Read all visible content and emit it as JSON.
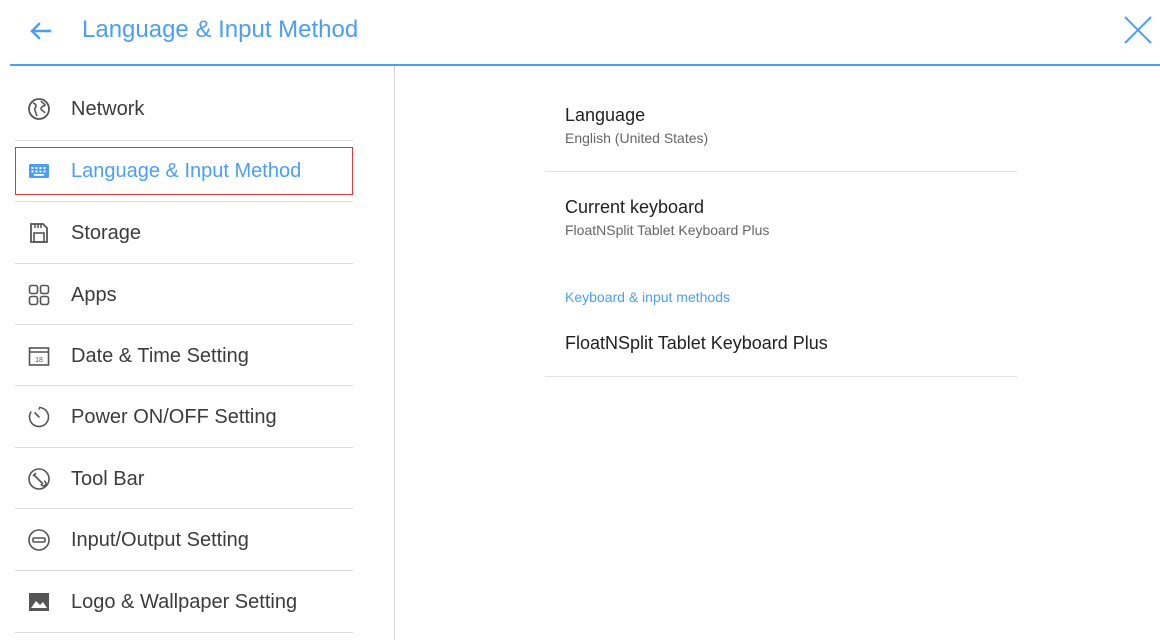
{
  "header": {
    "title": "Language & Input Method",
    "back_icon": "arrow-left-icon",
    "close_icon": "close-icon",
    "accent_color": "#4a9ff5"
  },
  "sidebar": {
    "items": [
      {
        "label": "Network",
        "icon": "globe-icon",
        "active": false
      },
      {
        "label": "Language & Input Method",
        "icon": "keyboard-icon",
        "active": true
      },
      {
        "label": "Storage",
        "icon": "sd-card-icon",
        "active": false
      },
      {
        "label": "Apps",
        "icon": "apps-grid-icon",
        "active": false
      },
      {
        "label": "Date & Time Setting",
        "icon": "calendar-icon",
        "calendar_day": "18",
        "active": false
      },
      {
        "label": "Power ON/OFF Setting",
        "icon": "timer-icon",
        "active": false
      },
      {
        "label": "Tool Bar",
        "icon": "toolbar-icon",
        "active": false
      },
      {
        "label": "Input/Output Setting",
        "icon": "input-output-icon",
        "active": false
      },
      {
        "label": "Logo & Wallpaper Setting",
        "icon": "image-icon",
        "active": false
      }
    ],
    "highlight_border_color": "#e0393b"
  },
  "content": {
    "language": {
      "title": "Language",
      "value": "English (United States)"
    },
    "current_keyboard": {
      "title": "Current keyboard",
      "value": "FloatNSplit Tablet Keyboard Plus"
    },
    "keyboard_section": {
      "heading": "Keyboard & input methods",
      "items": [
        "FloatNSplit Tablet Keyboard Plus"
      ]
    }
  }
}
